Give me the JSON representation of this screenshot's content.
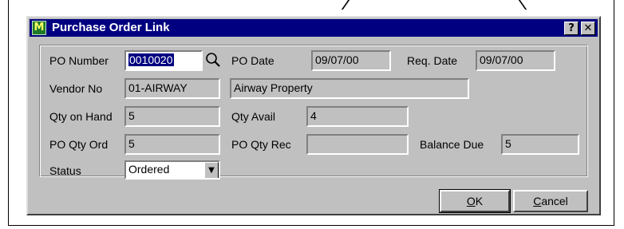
{
  "window": {
    "title": "Purchase Order Link",
    "app_icon_glyph": "M",
    "help_glyph": "?",
    "close_glyph": "✕"
  },
  "fields": {
    "po_number": {
      "label": "PO Number",
      "value": "0010020",
      "lookup_icon": "magnifier-icon"
    },
    "po_date": {
      "label": "PO Date",
      "value": "09/07/00"
    },
    "req_date": {
      "label": "Req. Date",
      "value": "09/07/00"
    },
    "vendor_no": {
      "label": "Vendor No",
      "value": "01-AIRWAY"
    },
    "vendor_name": {
      "value": "Airway Property"
    },
    "qty_on_hand": {
      "label": "Qty on Hand",
      "value": "5"
    },
    "qty_avail": {
      "label": "Qty Avail",
      "value": "4"
    },
    "po_qty_ord": {
      "label": "PO Qty Ord",
      "value": "5"
    },
    "po_qty_rec": {
      "label": "PO Qty Rec",
      "value": ""
    },
    "balance_due": {
      "label": "Balance Due",
      "value": "5"
    },
    "status": {
      "label": "Status",
      "value": "Ordered",
      "arrow": "▼"
    }
  },
  "buttons": {
    "ok": {
      "accel": "O",
      "rest": "K"
    },
    "cancel": {
      "accel": "C",
      "rest": "ancel"
    }
  },
  "colors": {
    "titlebar": "#000080",
    "face": "#c0c0c0",
    "selection": "#000080"
  }
}
